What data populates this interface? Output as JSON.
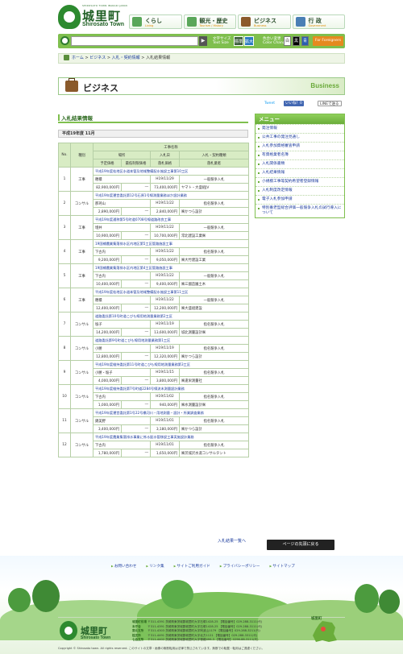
{
  "header": {
    "logo_sub": "SHIROSATO TOWN IBARAKI JAPAN",
    "logo_name": "城里町",
    "logo_en": "Shirosato Town",
    "nav": [
      {
        "label": "くらし",
        "en": "Living"
      },
      {
        "label": "観光・歴史",
        "en": "Tourism / History"
      },
      {
        "label": "ビジネス",
        "en": "Business"
      },
      {
        "label": "行 政",
        "en": "Government"
      }
    ],
    "search_button": "▶",
    "font_size_label_ja": "文字サイズ",
    "font_size_label_en": "Text Size",
    "font_standard": "標準",
    "font_large": "拡大",
    "color_label_ja": "色合い変更",
    "color_label_en": "Color Change",
    "colors": [
      "白",
      "黒",
      "青"
    ],
    "foreign_button": "For Foreigners"
  },
  "breadcrumb": {
    "home": "ホーム",
    "sep": ">",
    "items": [
      "ビジネス",
      "入札・契約情報",
      "入札結果情報"
    ]
  },
  "page_title": {
    "ja": "ビジネス",
    "en": "Business"
  },
  "social": {
    "tweet": "Tweet",
    "like": "いいね！0",
    "line": "LINEで送る"
  },
  "section": {
    "title": "入札結果情報",
    "period": "平成19年度 11月"
  },
  "table_head": {
    "no": "No.",
    "kind": "種別",
    "work_name": "工事名称",
    "place": "場所",
    "bid_date": "入札日",
    "method": "入札・契約種類",
    "planned_price": "予定価格",
    "min_price": "最低制限価格",
    "contract_price": "落札価格",
    "winner": "落札業者"
  },
  "rows": [
    {
      "no": "1",
      "kind": "工事",
      "name": "平成19年度桂地区水道本管及地域整備配水施設工事第10工区",
      "place": "穂積",
      "date": "H19/11/29",
      "method": "一般競争入札",
      "planned": "82,900,000円",
      "min": "―",
      "contract": "73,400,000円",
      "winner": "ヤマト・大盛組JV"
    },
    {
      "no": "2",
      "kind": "コンサル",
      "name": "平成19年度運営委託第12号石原1号線測量業務ほか設計業務",
      "place": "那珂山",
      "date": "H19/11/22",
      "method": "指名競争入札",
      "planned": "2,890,000円",
      "min": "―",
      "contract": "2,840,000円",
      "winner": "㈱かつら設計"
    },
    {
      "no": "3",
      "kind": "工事",
      "name": "平成19年度通称第5号町道0708号線道路改良工事",
      "place": "増井",
      "date": "H19/11/22",
      "method": "一般競争入札",
      "planned": "10,900,000円",
      "min": "―",
      "contract": "10,700,000円",
      "winner": "常北建設工業㈱"
    },
    {
      "no": "4",
      "kind": "工事",
      "name": "19国補農業集落排水区内地区第5工区管路施設工事",
      "place": "下古内",
      "date": "H19/11/22",
      "method": "指名競争入札",
      "planned": "9,200,000円",
      "min": "―",
      "contract": "9,050,000円",
      "winner": "㈱大竹建設工業"
    },
    {
      "no": "5",
      "kind": "工事",
      "name": "19国補農業集落排水区内地区第4工区管路施設工事",
      "place": "下古内",
      "date": "H19/11/22",
      "method": "一般競争入札",
      "planned": "10,400,000円",
      "min": "―",
      "contract": "9,400,000円",
      "winner": "㈱三國造園土木"
    },
    {
      "no": "6",
      "kind": "工事",
      "name": "平成19年度桂地区水道本管及地域整備配水施設工事第11工区",
      "place": "穂積",
      "date": "H19/11/22",
      "method": "一般競争入札",
      "planned": "12,400,000円",
      "min": "―",
      "contract": "12,200,000円",
      "winner": "㈱大盛組建設"
    },
    {
      "no": "7",
      "kind": "コンサル",
      "name": "道路委託第10号町道こびも線用地測量業務第2工区",
      "place": "塩子",
      "date": "H19/11/19",
      "method": "指名競争入札",
      "planned": "14,200,000円",
      "min": "―",
      "contract": "13,600,000円",
      "winner": "城北測量設計㈱"
    },
    {
      "no": "8",
      "kind": "コンサル",
      "name": "道路委託第9号町道こびも線用地測量業務第1工区",
      "place": "小勝",
      "date": "H19/11/19",
      "method": "指名競争入札",
      "planned": "12,800,000円",
      "min": "―",
      "contract": "12,320,000円",
      "winner": "㈱かつら設計"
    },
    {
      "no": "9",
      "kind": "コンサル",
      "name": "平成19年度維持委託第11号町道こびも線用地測量業務第3工区",
      "place": "小勝・塩子",
      "date": "H19/11/15",
      "method": "指名競争入札",
      "planned": "4,000,000円",
      "min": "―",
      "contract": "3,800,000円",
      "winner": "㈱逢栄測量社"
    },
    {
      "no": "10",
      "kind": "コンサル",
      "name": "平成19年度維持委託第7号町道2284号線流末測量設計業務",
      "place": "下古内",
      "date": "H19/11/02",
      "method": "指名競争入札",
      "planned": "1,000,000円",
      "min": "―",
      "contract": "940,000円",
      "winner": "㈱水測量設計㈱"
    },
    {
      "no": "11",
      "kind": "コンサル",
      "name": "平成19年度運営委託第1号22号橋河川・用地測量・設計・所業調査業務",
      "place": "錦美野",
      "date": "H19/11/01",
      "method": "指名競争入札",
      "planned": "3,400,000円",
      "min": "―",
      "contract": "3,180,000円",
      "winner": "㈱かつら設計"
    },
    {
      "no": "12",
      "kind": "コンサル",
      "name": "平成19年度農業集落排水事業に係る配水管移設工事実施設計業務",
      "place": "下古内",
      "date": "H19/11/01",
      "method": "指名競争入札",
      "planned": "1,780,000円",
      "min": "―",
      "contract": "1,650,000円",
      "winner": "㈱茨城沢水道コンサルタント"
    }
  ],
  "back_link": "入札結果一覧へ",
  "menu": {
    "title": "メニュー",
    "items": [
      "発注情報",
      "公共工事の発注見通し",
      "入札参加資格審査申請",
      "有資格業者名簿",
      "入札関係書類",
      "入札結果情報",
      "小規模工事等契約希望者登録情報",
      "入札制度改定情報",
      "電子入札参加申請",
      "特別養老型総合評価一般競争入札の試行導入について"
    ]
  },
  "page_top": "ページの先頭に戻る",
  "footer": {
    "nav": [
      "お問い合わせ",
      "リンク集",
      "サイトご利用ガイド",
      "プライバシーポリシー",
      "サイトマップ"
    ],
    "logo_sub": "SHIROSATO TOWN IBARAKI JAPAN",
    "logo_name": "城里町",
    "logo_en": "Shirosato Town",
    "addresses": [
      {
        "label": "城里町役場",
        "text": "〒311-4391 茨城県東茨城郡城里町大字石塚1428-25  【電話番号】029-288-3111(代)"
      },
      {
        "label": "本庁舎",
        "text": "〒311-4391 茨城県東茨城郡城里町大字石塚1428-25  【電話番号】029-288-3111(代)"
      },
      {
        "label": "常北支所",
        "text": "〒311-4303 茨城県東茨城郡城里町大字阿波山1179  【電話番号】029-288-3211(代)"
      },
      {
        "label": "桂支所",
        "text": "〒311-4491 茨城県東茨城郡城里町大字北方1121  【電話番号】029-288-3311(代)"
      },
      {
        "label": "七会支所",
        "text": "〒311-4402 茨城県東茨城郡城里町大字徳蔵499-3  【電話番号】0296-88-3111(代)"
      }
    ],
    "map_label": "城里町",
    "copyright": "Copyright © Shirosato town. All rights reserved.      このサイトの文章・画像の無断転用は法律で禁止されています。無断での転載・転用はご遠慮ください。"
  }
}
